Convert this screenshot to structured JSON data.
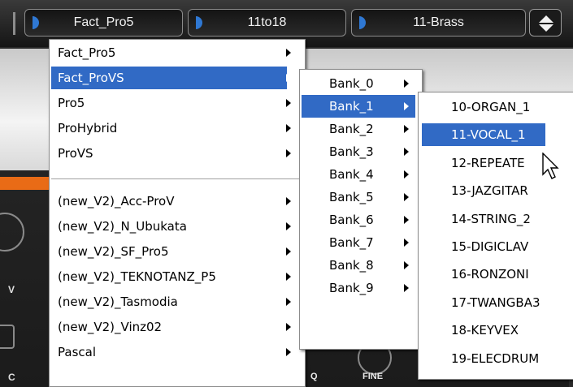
{
  "toolbar": {
    "patch_selector": "Fact_Pro5",
    "range_selector": "11to18",
    "program_selector": "11-Brass"
  },
  "background": {
    "left_label_v": "V",
    "left_label_c": "C",
    "dial_label_q": "Q",
    "dial_label_fine": "FINE"
  },
  "menu1": {
    "items": [
      {
        "label": "Fact_Pro5",
        "submenu": true,
        "selected": false
      },
      {
        "label": "Fact_ProVS",
        "submenu": true,
        "selected": true
      },
      {
        "label": "Pro5",
        "submenu": true,
        "selected": false
      },
      {
        "label": "ProHybrid",
        "submenu": true,
        "selected": false
      },
      {
        "label": "ProVS",
        "submenu": true,
        "selected": false
      },
      {
        "separator": true
      },
      {
        "label": "(new_V2)_Acc-ProV",
        "submenu": true,
        "selected": false
      },
      {
        "label": "(new_V2)_N_Ubukata",
        "submenu": true,
        "selected": false
      },
      {
        "label": "(new_V2)_SF_Pro5",
        "submenu": true,
        "selected": false
      },
      {
        "label": "(new_V2)_TEKNOTANZ_P5",
        "submenu": true,
        "selected": false
      },
      {
        "label": "(new_V2)_Tasmodia",
        "submenu": true,
        "selected": false
      },
      {
        "label": "(new_V2)_Vinz02",
        "submenu": true,
        "selected": false
      },
      {
        "label": "Pascal",
        "submenu": true,
        "selected": false
      }
    ]
  },
  "menu2": {
    "items": [
      {
        "label": "Bank_0",
        "submenu": true,
        "selected": false
      },
      {
        "label": "Bank_1",
        "submenu": true,
        "selected": true
      },
      {
        "label": "Bank_2",
        "submenu": true,
        "selected": false
      },
      {
        "label": "Bank_3",
        "submenu": true,
        "selected": false
      },
      {
        "label": "Bank_4",
        "submenu": true,
        "selected": false
      },
      {
        "label": "Bank_5",
        "submenu": true,
        "selected": false
      },
      {
        "label": "Bank_6",
        "submenu": true,
        "selected": false
      },
      {
        "label": "Bank_7",
        "submenu": true,
        "selected": false
      },
      {
        "label": "Bank_8",
        "submenu": true,
        "selected": false
      },
      {
        "label": "Bank_9",
        "submenu": true,
        "selected": false
      }
    ]
  },
  "menu3": {
    "items": [
      {
        "label": "10-ORGAN_1",
        "selected": false
      },
      {
        "label": "11-VOCAL_1",
        "selected": true
      },
      {
        "label": "12-REPEATE",
        "selected": false
      },
      {
        "label": "13-JAZGITAR",
        "selected": false
      },
      {
        "label": "14-STRING_2",
        "selected": false
      },
      {
        "label": "15-DIGICLAV",
        "selected": false
      },
      {
        "label": "16-RONZONI",
        "selected": false
      },
      {
        "label": "17-TWANGBA3",
        "selected": false
      },
      {
        "label": "18-KEYVEX",
        "selected": false
      },
      {
        "label": "19-ELECDRUM",
        "selected": false
      }
    ]
  },
  "colors": {
    "selection": "#316ac5",
    "knob_accent": "#2f78d3"
  }
}
